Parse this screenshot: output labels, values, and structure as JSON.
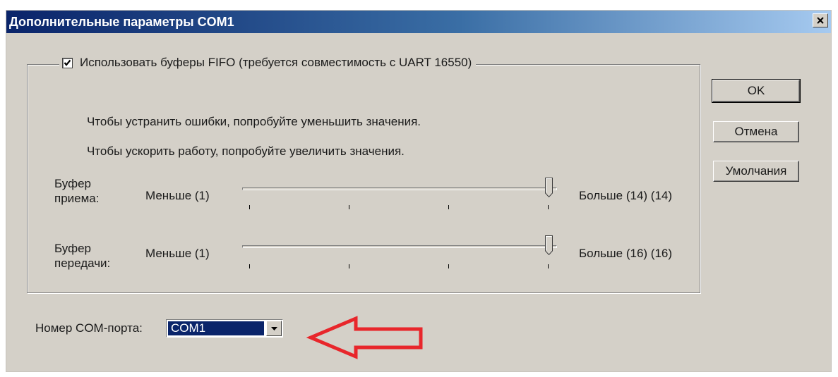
{
  "window": {
    "title": "Дополнительные параметры COM1"
  },
  "fifo": {
    "checkbox_label": "Использовать буферы FIFO (требуется совместимость с UART 16550)",
    "checked": true
  },
  "hints": {
    "fix_errors": "Чтобы устранить ошибки, попробуйте уменьшить значения.",
    "speed_up": "Чтобы ускорить работу, попробуйте увеличить значения."
  },
  "receive_buffer": {
    "label_line1": "Буфер",
    "label_line2": "приема:",
    "min_label": "Меньше (1)",
    "max_label": "Больше (14)",
    "current_display": "(14)",
    "value": 14,
    "min": 1,
    "max": 14
  },
  "transmit_buffer": {
    "label_line1": "Буфер",
    "label_line2": "передачи:",
    "min_label": "Меньше (1)",
    "max_label": "Больше (16)",
    "current_display": "(16)",
    "value": 16,
    "min": 1,
    "max": 16
  },
  "com_port": {
    "label": "Номер COM-порта:",
    "selected": "COM1"
  },
  "buttons": {
    "ok": "OK",
    "cancel": "Отмена",
    "defaults": "Умолчания"
  },
  "colors": {
    "titlebar_start": "#0a246a",
    "titlebar_end": "#a6caf0",
    "dialog_bg": "#d4d0c8",
    "selection_bg": "#0a246a",
    "annotation_arrow": "#e8262b"
  },
  "icons": {
    "close": "close-icon",
    "checkmark": "checkmark-icon",
    "dropdown": "chevron-down-icon",
    "annotation": "arrow-left-icon"
  }
}
